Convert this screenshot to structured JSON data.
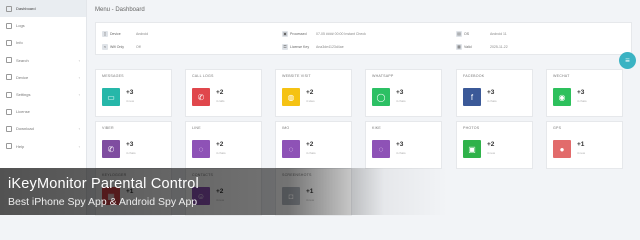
{
  "header": {
    "title": "Menu - Dashboard"
  },
  "sidebar": {
    "items": [
      {
        "label": "Dashboard",
        "icon": "dashboard-icon",
        "active": true,
        "caret": false
      },
      {
        "label": "Logs",
        "icon": "logs-icon",
        "active": false,
        "caret": false
      },
      {
        "label": "Info",
        "icon": "info-icon",
        "active": false,
        "caret": false
      },
      {
        "label": "Search",
        "icon": "search-icon",
        "active": false,
        "caret": true
      },
      {
        "label": "Device",
        "icon": "device-icon",
        "active": false,
        "caret": true
      },
      {
        "label": "Settings",
        "icon": "gear-icon",
        "active": false,
        "caret": true
      },
      {
        "label": "License",
        "icon": "license-icon",
        "active": false,
        "caret": false
      },
      {
        "label": "Download",
        "icon": "download-icon",
        "active": false,
        "caret": true
      },
      {
        "label": "Help",
        "icon": "help-icon",
        "active": false,
        "caret": true
      }
    ]
  },
  "info": {
    "device": {
      "label": "Device",
      "value": "Android",
      "icon": "device-icon"
    },
    "wifi": {
      "label": "Wifi Only",
      "value": "Off",
      "icon": "wifi-icon"
    },
    "processed": {
      "label": "Processed",
      "value": "07-05 #### 00:00 Instant Check",
      "icon": "processed-icon"
    },
    "license_key": {
      "label": "License Key",
      "value": "Ana3de4123d4ae",
      "icon": "key-icon"
    },
    "os": {
      "label": "OS",
      "value": "Android 11",
      "icon": "os-icon"
    },
    "valid": {
      "label": "Valid",
      "value": "2025-11-22",
      "icon": "calendar-icon"
    }
  },
  "fab": {
    "icon": "menu-icon"
  },
  "tiles": [
    {
      "title": "MESSAGES",
      "count": "+3",
      "sub": "4 new",
      "color": "#26b7a9",
      "icon": "message-icon",
      "glyph": "▭"
    },
    {
      "title": "CALL LOGS",
      "count": "+2",
      "sub": "4 calls",
      "color": "#e0474c",
      "icon": "phone-icon",
      "glyph": "✆"
    },
    {
      "title": "WEBSITE VISIT",
      "count": "+2",
      "sub": "4 sites",
      "color": "#f5c213",
      "icon": "globe-icon",
      "glyph": "◍"
    },
    {
      "title": "WHATSAPP",
      "count": "+3",
      "sub": "4 chats",
      "color": "#2cc064",
      "icon": "whatsapp-icon",
      "glyph": "◯"
    },
    {
      "title": "FACEBOOK",
      "count": "+3",
      "sub": "4 chats",
      "color": "#3b5998",
      "icon": "facebook-icon",
      "glyph": "f"
    },
    {
      "title": "WECHAT",
      "count": "+3",
      "sub": "4 chats",
      "color": "#2dc05c",
      "icon": "wechat-icon",
      "glyph": "◉"
    },
    {
      "title": "VIBER",
      "count": "+3",
      "sub": "4 chats",
      "color": "#7f4da0",
      "icon": "viber-icon",
      "glyph": "✆"
    },
    {
      "title": "LINE",
      "count": "+2",
      "sub": "4 chats",
      "color": "#8e52b6",
      "icon": "line-icon",
      "glyph": "◌"
    },
    {
      "title": "IMO",
      "count": "+2",
      "sub": "4 chats",
      "color": "#8e52b6",
      "icon": "imo-icon",
      "glyph": "◌"
    },
    {
      "title": "KIKE",
      "count": "+3",
      "sub": "4 chats",
      "color": "#8e52b6",
      "icon": "kik-icon",
      "glyph": "◌"
    },
    {
      "title": "PHOTOS",
      "count": "+2",
      "sub": "4 new",
      "color": "#2fb24a",
      "icon": "photo-icon",
      "glyph": "▣"
    },
    {
      "title": "GPS",
      "count": "+1",
      "sub": "4 new",
      "color": "#e26b6b",
      "icon": "location-icon",
      "glyph": "●"
    },
    {
      "title": "KEYLOGGER",
      "count": "+1",
      "sub": "4 new",
      "color": "#e0474c",
      "icon": "keylogger-icon",
      "glyph": "▦"
    },
    {
      "title": "CONTACTS",
      "count": "+2",
      "sub": "4 new",
      "color": "#8e52b6",
      "icon": "contacts-icon",
      "glyph": "☺"
    },
    {
      "title": "SCREENSHOTS",
      "count": "+1",
      "sub": "4 new",
      "color": "#b6bcc4",
      "icon": "camera-icon",
      "glyph": "◘"
    }
  ],
  "overlay": {
    "title": "iKeyMonitor Parental Control",
    "subtitle": "Best iPhone Spy App & Android Spy App"
  }
}
